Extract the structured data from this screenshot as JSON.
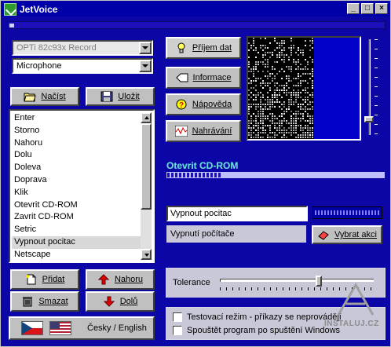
{
  "window": {
    "title": "JetVoice"
  },
  "titlebar_buttons": {
    "minimize": "_",
    "maximize": "□",
    "close": "×"
  },
  "audio": {
    "device": "OPTi 82c93x Record",
    "input": "Microphone"
  },
  "buttons": {
    "load": "Načíst",
    "save": "Uložit",
    "receive": "Příjem dat",
    "info": "Informace",
    "help": "Nápověda",
    "record": "Nahrávání",
    "add": "Přidat",
    "delete": "Smazat",
    "up": "Nahoru",
    "down": "Dolů",
    "choose_action": "Vybrat akci",
    "language": "Česky / English"
  },
  "commands": [
    "Enter",
    "Storno",
    "Nahoru",
    "Dolu",
    "Doleva",
    "Doprava",
    "Klik",
    "Otevrit CD-ROM",
    "Zavrit CD-ROM",
    "Setric",
    "Vypnout pocitac",
    "Netscape"
  ],
  "selected_command_index": 10,
  "recognized": {
    "title": "Otevrit CD-ROM",
    "level": 0.25
  },
  "command": {
    "phrase": "Vypnout pocitac",
    "action": "Vypnutí počítače"
  },
  "tolerance": {
    "label": "Tolerance",
    "value": 0.65
  },
  "options": {
    "test_mode": "Testovací režim - příkazy se neprovádějí",
    "autostart": "Spouštět program po spuštění Windows"
  },
  "watermark": "INSTALUJ.CZ",
  "colors": {
    "background": "#0c06a6",
    "accent": "#66d9d9",
    "title": "#0000a8"
  }
}
